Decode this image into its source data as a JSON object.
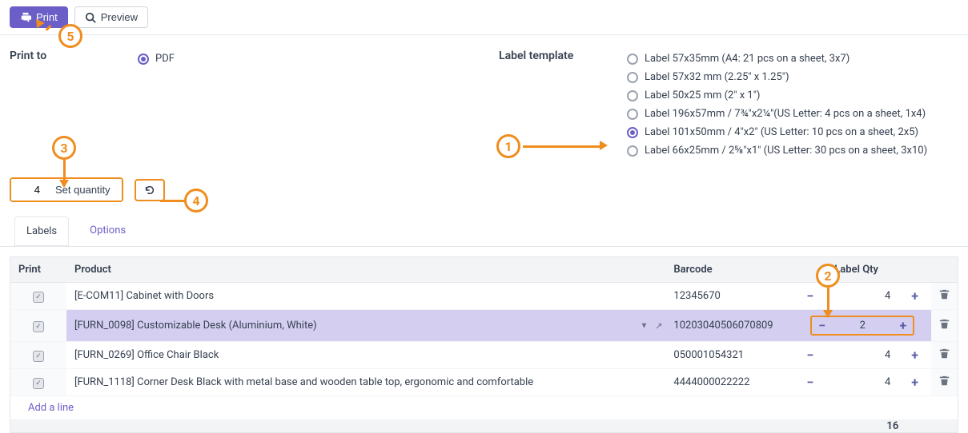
{
  "toolbar": {
    "print_label": "Print",
    "preview_label": "Preview"
  },
  "form": {
    "print_to_label": "Print to",
    "print_to_value": "PDF",
    "label_template_label": "Label template",
    "label_templates": [
      {
        "label": "Label 57x35mm (A4: 21 pcs on a sheet, 3x7)",
        "selected": false
      },
      {
        "label": "Label 57x32 mm (2.25\" x 1.25\")",
        "selected": false
      },
      {
        "label": "Label 50x25 mm (2\" x 1\")",
        "selected": false
      },
      {
        "label": "Label 196x57mm / 7¾\"x2¼\"(US Letter: 4 pcs on a sheet, 1x4)",
        "selected": false
      },
      {
        "label": "Label 101x50mm / 4\"x2\" (US Letter: 10 pcs on a sheet, 2x5)",
        "selected": true
      },
      {
        "label": "Label 66x25mm / 2⅝\"x1\" (US Letter: 30 pcs on a sheet, 3x10)",
        "selected": false
      }
    ]
  },
  "qty": {
    "value": "4",
    "set_label": "Set quantity"
  },
  "tabs": {
    "labels": "Labels",
    "options": "Options"
  },
  "table": {
    "headers": {
      "print": "Print",
      "product": "Product",
      "barcode": "Barcode",
      "label_qty": "Label Qty"
    },
    "rows": [
      {
        "checked": true,
        "product": "[E-COM11] Cabinet with Doors",
        "barcode": "12345670",
        "qty": "4",
        "selected": false
      },
      {
        "checked": true,
        "product": "[FURN_0098] Customizable Desk (Aluminium, White)",
        "barcode": "10203040506070809",
        "qty": "2",
        "selected": true
      },
      {
        "checked": true,
        "product": "[FURN_0269] Office Chair Black",
        "barcode": "050001054321",
        "qty": "4",
        "selected": false
      },
      {
        "checked": true,
        "product": "[FURN_1118] Corner Desk Black with metal base and wooden table top, ergonomic and comfortable",
        "barcode": "4444000022222",
        "qty": "4",
        "selected": false
      }
    ],
    "add_line": "Add a line",
    "footer_total": "16"
  },
  "annotations": {
    "a1": "1",
    "a2": "2",
    "a3": "3",
    "a4": "4",
    "a5": "5"
  }
}
